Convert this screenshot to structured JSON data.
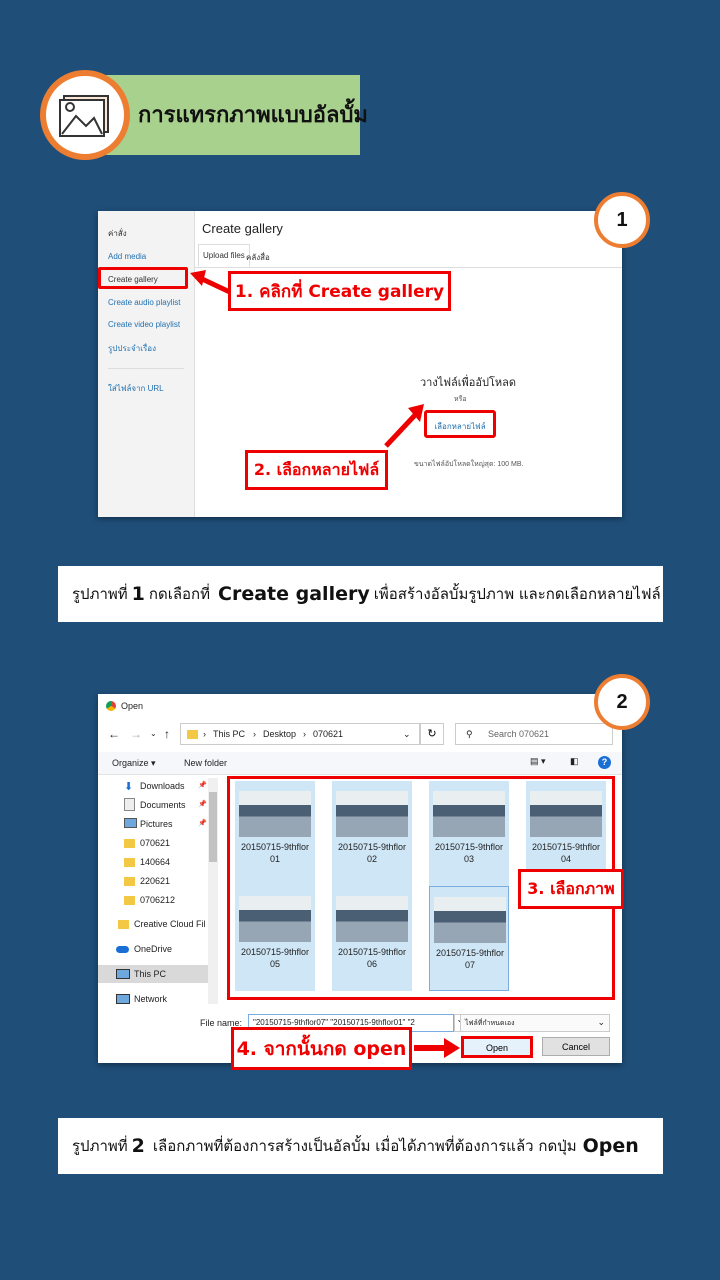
{
  "header": {
    "title": "การแทรกภาพแบบอัลบั้ม"
  },
  "colors": {
    "background": "#1f4e79",
    "accent": "#ed7d31",
    "header_bar": "#a9d18e",
    "highlight": "#e00000"
  },
  "panel1": {
    "number": "1",
    "sidebar": [
      "ค่าสั่ง",
      "Add media",
      "Create gallery",
      "Create audio playlist",
      "Create video playlist",
      "รูปประจำเรื่อง",
      "ใส่ไฟล์จาก URL"
    ],
    "title": "Create gallery",
    "tabs": [
      "Upload files",
      "คลังสื่อ"
    ],
    "drop_text": "วางไฟล์เพื่ออัปโหลด",
    "or_text": "หรือ",
    "select_button": "เลือกหลายไฟล์",
    "max_size": "ขนาดไฟล์อัปโหลดใหญ่สุด: 100 MB.",
    "callout1": "1. คลิกที่ Create gallery",
    "callout2": "2. เลือกหลายไฟล์"
  },
  "caption1": {
    "prefix": "รูปภาพที่",
    "num": "1",
    "text_a": "กดเลือกที่",
    "bold": "Create gallery",
    "text_b": "เพื่อสร้างอัลบั้มรูปภาพ และกดเลือกหลายไฟล์"
  },
  "panel2": {
    "number": "2",
    "window_title": "Open",
    "path": [
      "This PC",
      "Desktop",
      "070621"
    ],
    "search_placeholder": "Search 070621",
    "organize": "Organize ▾",
    "new_folder": "New folder",
    "nav": [
      "Downloads",
      "Documents",
      "Pictures",
      "070621",
      "140664",
      "220621",
      "0706212",
      "Creative Cloud Fil",
      "OneDrive",
      "This PC",
      "Network"
    ],
    "files": [
      {
        "line1": "20150715-9thflor",
        "line2": "01"
      },
      {
        "line1": "20150715-9thflor",
        "line2": "02"
      },
      {
        "line1": "20150715-9thflor",
        "line2": "03"
      },
      {
        "line1": "20150715-9thflor",
        "line2": "04"
      },
      {
        "line1": "20150715-9thflor",
        "line2": "05"
      },
      {
        "line1": "20150715-9thflor",
        "line2": "06"
      },
      {
        "line1": "20150715-9thflor",
        "line2": "07"
      }
    ],
    "filename_label": "File name:",
    "filename_value": "\"20150715-9thflor07\" \"20150715-9thflor01\" \"2",
    "filetype": "ไฟล์ที่กำหนดเอง",
    "open_button": "Open",
    "cancel_button": "Cancel",
    "callout3": "3. เลือกภาพ",
    "callout4": "4. จากนั้นกด open"
  },
  "caption2": {
    "prefix": "รูปภาพที่",
    "num": "2",
    "text_a": "เลือกภาพที่ต้องการสร้างเป็นอัลบั้ม เมื่อได้ภาพที่ต้องการแล้ว กดปุ่ม",
    "bold": "Open"
  }
}
